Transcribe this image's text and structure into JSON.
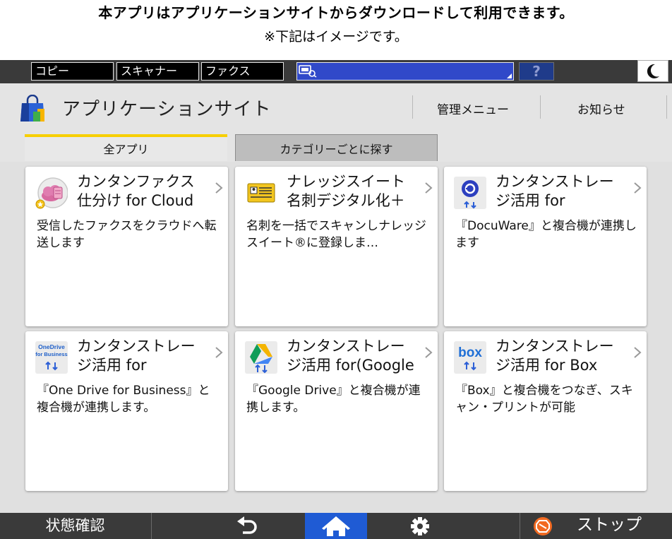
{
  "caption": {
    "line1": "本アプリはアプリケーションサイトからダウンロードして利用できます。",
    "line2": "※下記はイメージです。"
  },
  "system_bar": {
    "modes": [
      "コピー",
      "スキャナー",
      "ファクス"
    ],
    "help_label": "?",
    "theme_icon": "moon-icon"
  },
  "header": {
    "title": "アプリケーションサイト",
    "admin_menu": "管理メニュー",
    "notices": "お知らせ"
  },
  "tabs": [
    {
      "label": "全アプリ",
      "active": true
    },
    {
      "label": "カテゴリーごとに探す",
      "active": false
    }
  ],
  "apps": [
    {
      "title1": "カンタンファクス",
      "title2": "仕分け for Cloud",
      "desc": "受信したファクスをクラウドへ転送します",
      "icon": "fax-cloud-icon"
    },
    {
      "title1": "ナレッジスイート",
      "title2": "名刺デジタル化＋",
      "desc": "名刺を一括でスキャンしナレッジスイート®に登録しま…",
      "icon": "business-card-icon"
    },
    {
      "title1": "カンタンストレー",
      "title2": "ジ活用 for",
      "desc": "『DocuWare』と複合機が連携します",
      "icon": "docuware-icon"
    },
    {
      "title1": "カンタンストレー",
      "title2": "ジ活用 for",
      "desc": "『One Drive for Business』と複合機が連携します。",
      "icon": "onedrive-icon",
      "icon_text1": "OneDrive",
      "icon_text2": "for Business"
    },
    {
      "title1": "カンタンストレー",
      "title2": "ジ活用 for(Google",
      "desc": "『Google Drive』と複合機が連携します。",
      "icon": "google-drive-icon"
    },
    {
      "title1": "カンタンストレー",
      "title2": "ジ活用 for Box",
      "desc": "『Box』と複合機をつなぎ、スキャン・プリントが可能",
      "icon": "box-icon",
      "icon_text1": "box"
    }
  ],
  "bottom_bar": {
    "status_label": "状態確認",
    "stop_label": "ストップ"
  },
  "colors": {
    "accent_tab": "#f7cf00",
    "home_button": "#1f5bd4",
    "job_bar": "#3049c9",
    "stop_icon": "#f26a21"
  }
}
